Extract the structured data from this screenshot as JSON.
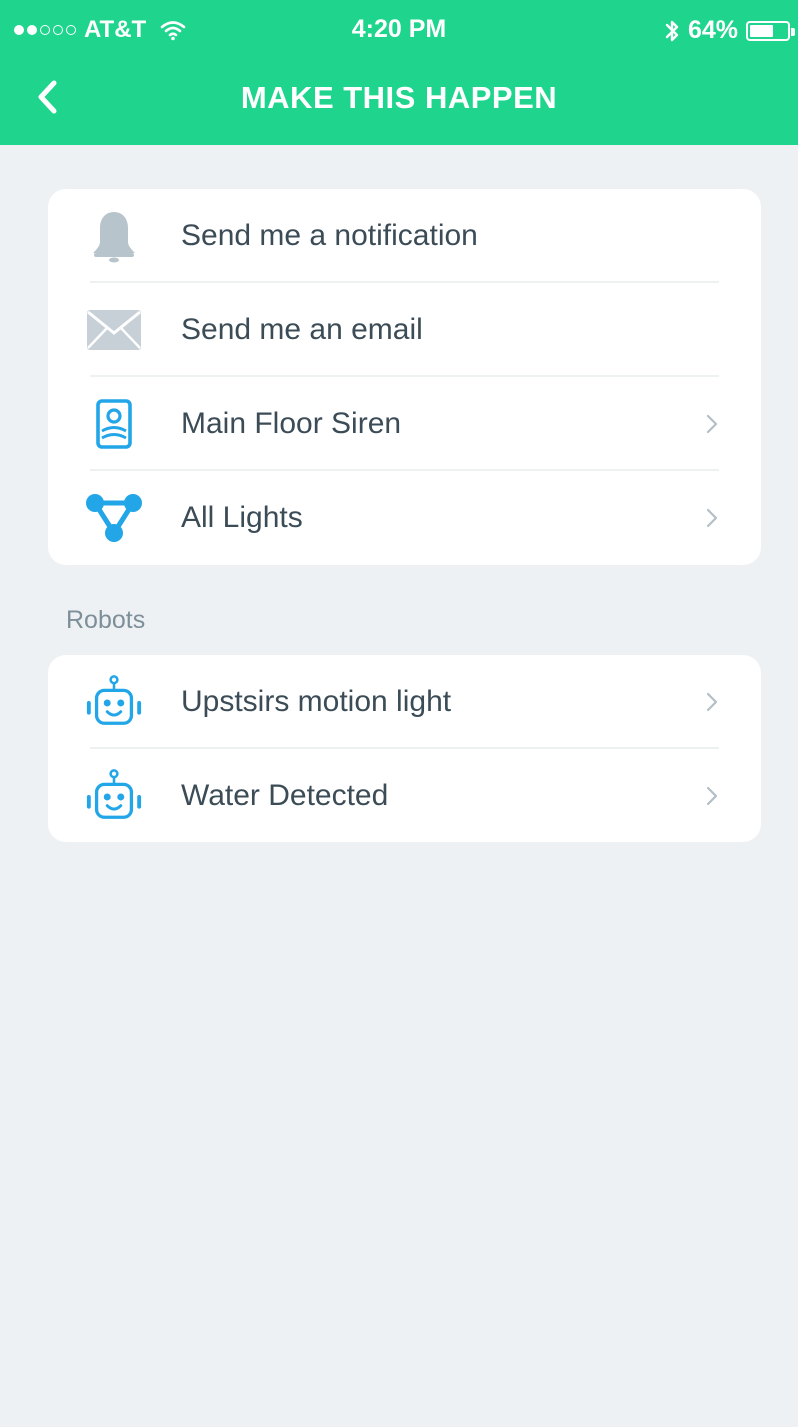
{
  "status_bar": {
    "carrier": "AT&T",
    "time": "4:20 PM",
    "battery_percent": "64%",
    "battery_level": 0.64,
    "signal_bars_filled": 2,
    "signal_bars_total": 5
  },
  "header": {
    "title": "MAKE THIS HAPPEN",
    "background_color": "#1fd58d"
  },
  "actions": [
    {
      "label": "Send me a notification",
      "icon": "bell-icon",
      "has_chevron": false
    },
    {
      "label": "Send me an email",
      "icon": "envelope-icon",
      "has_chevron": false
    },
    {
      "label": "Main Floor Siren",
      "icon": "siren-device-icon",
      "has_chevron": true
    },
    {
      "label": "All Lights",
      "icon": "light-group-icon",
      "has_chevron": true
    }
  ],
  "robots_section": {
    "title": "Robots",
    "items": [
      {
        "label": "Upstsirs motion light",
        "icon": "robot-icon",
        "has_chevron": true
      },
      {
        "label": "Water Detected",
        "icon": "robot-icon",
        "has_chevron": true
      }
    ]
  },
  "colors": {
    "accent_blue": "#22a6e8",
    "icon_gray": "#b8c4cb",
    "text": "#3c4c57",
    "background": "#eef1f3"
  }
}
